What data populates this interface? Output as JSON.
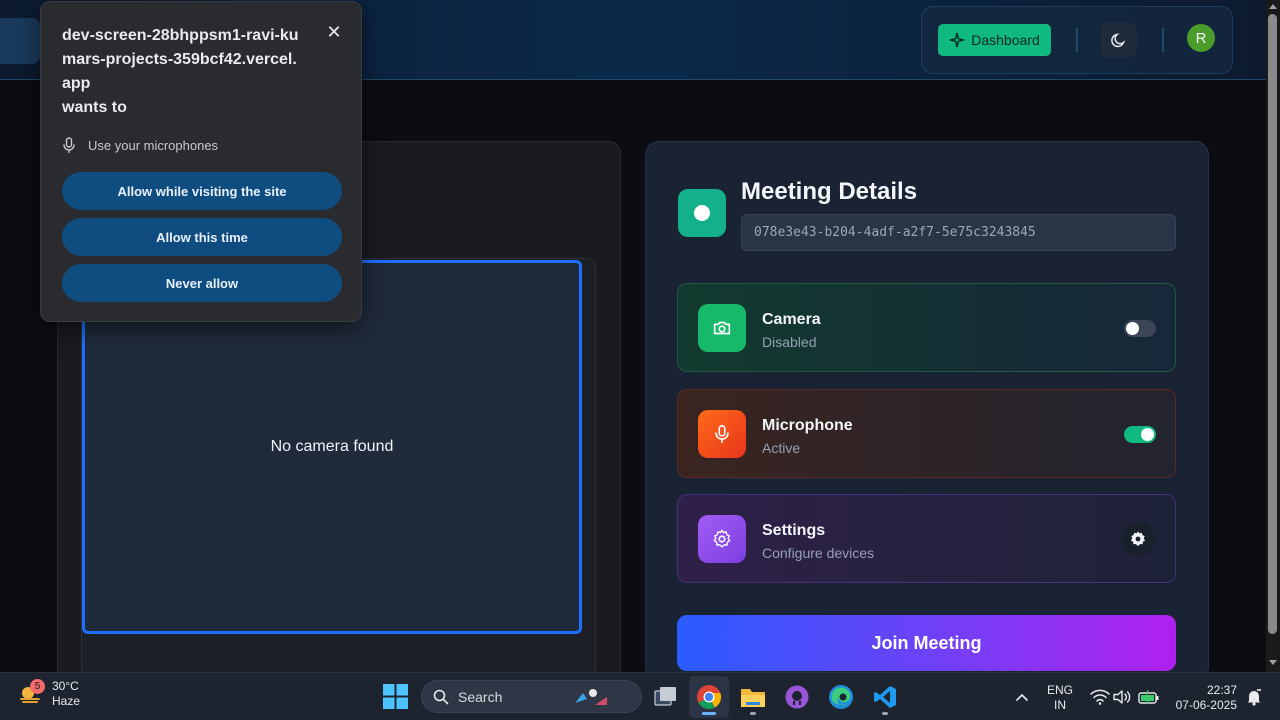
{
  "header": {
    "dashboard_label": "Dashboard",
    "avatar_initial": "R"
  },
  "permission_prompt": {
    "origin": "dev-screen-28bhppsm1-ravi-kumars-projects-359bcf42.vercel.app",
    "wants_to": "wants to",
    "request": "Use your microphones",
    "allow_visiting": "Allow while visiting the site",
    "allow_once": "Allow this time",
    "never_allow": "Never allow"
  },
  "video": {
    "no_camera_text": "No camera found"
  },
  "meeting": {
    "title": "Meeting Details",
    "meeting_id": "078e3e43-b204-4adf-a2f7-5e75c3243845",
    "camera": {
      "title": "Camera",
      "status": "Disabled",
      "enabled": false
    },
    "microphone": {
      "title": "Microphone",
      "status": "Active",
      "enabled": true
    },
    "settings": {
      "title": "Settings",
      "subtitle": "Configure devices"
    },
    "join_label": "Join Meeting"
  },
  "taskbar": {
    "weather_temp": "30°C",
    "weather_desc": "Haze",
    "weather_badge": "5",
    "search_label": "Search",
    "lang_top": "ENG",
    "lang_bottom": "IN",
    "time": "22:37",
    "date": "07-06-2025"
  },
  "colors": {
    "accent_green": "#10b981",
    "video_border": "#1e6fff",
    "prompt_button": "#0f4d80"
  }
}
